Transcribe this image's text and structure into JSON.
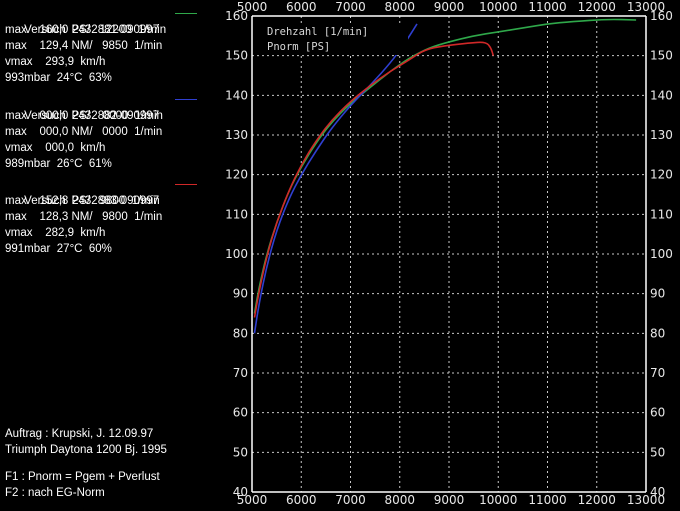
{
  "runs": [
    {
      "title": "Versuch  2432881-090997",
      "color": "#2fa84a",
      "lines": [
        "max    160,0 PS/   12200  1/min",
        "max    129,4 NM/   9850  1/min",
        "vmax    293,9  km/h",
        "993mbar  24°C  63%"
      ]
    },
    {
      "title": "Versuch  2432882-090997",
      "color": "#2f3fd0",
      "lines": [
        "max    000,0 PS/    0000  1/min",
        "max    000,0 NM/   0000  1/min",
        "vmax    000,0  km/h",
        "989mbar  26°C  61%"
      ]
    },
    {
      "title": "Versuch  2432883-090997",
      "color": "#d02828",
      "lines": [
        "max    152,8 PS/   9800  1/min",
        "max    128,3 NM/   9800  1/min",
        "vmax    282,9  km/h",
        "991mbar  27°C  60%"
      ]
    }
  ],
  "notes": {
    "order": "Auftrag : Krupski, J. 12.09.97",
    "vehicle": "Triumph Daytona 1200 Bj. 1995",
    "f1": "F1 : Pnorm = Pgem + Pverlust",
    "f2": "F2 : nach EG-Norm"
  },
  "chart_data": {
    "type": "line",
    "x_label": "Drehzahl [1/min]",
    "y_label": "Pnorm [PS]",
    "xlim": [
      5000,
      13000
    ],
    "ylim": [
      40,
      160
    ],
    "x_ticks": [
      5000,
      6000,
      7000,
      8000,
      9000,
      10000,
      11000,
      12000,
      13000
    ],
    "y_ticks": [
      40,
      50,
      60,
      70,
      80,
      90,
      100,
      110,
      120,
      130,
      140,
      150,
      160
    ],
    "grid": true,
    "axis_color": "#ffffff",
    "grid_color": "#c8c8c8",
    "series": [
      {
        "color": "#2fa84a",
        "points": [
          [
            5050,
            85
          ],
          [
            5150,
            92
          ],
          [
            5300,
            100
          ],
          [
            5500,
            108
          ],
          [
            5750,
            116
          ],
          [
            6000,
            122
          ],
          [
            6300,
            128
          ],
          [
            6600,
            133
          ],
          [
            7000,
            138
          ],
          [
            7400,
            142
          ],
          [
            7800,
            146
          ],
          [
            8200,
            149.5
          ],
          [
            8600,
            152
          ],
          [
            9000,
            153.5
          ],
          [
            9500,
            155
          ],
          [
            10000,
            156
          ],
          [
            10500,
            157
          ],
          [
            11000,
            158
          ],
          [
            11500,
            158.6
          ],
          [
            12200,
            159.2
          ],
          [
            12800,
            159
          ]
        ]
      },
      {
        "color": "#2f3fd0",
        "points": [
          [
            5050,
            80
          ],
          [
            5150,
            88
          ],
          [
            5300,
            97
          ],
          [
            5500,
            106
          ],
          [
            5750,
            114
          ],
          [
            6000,
            120
          ],
          [
            6300,
            126
          ],
          [
            6600,
            131.5
          ],
          [
            7000,
            137.5
          ],
          [
            7400,
            142.5
          ],
          [
            7800,
            148
          ],
          [
            8100,
            153
          ],
          [
            8350,
            158
          ]
        ]
      },
      {
        "color": "#d02828",
        "points": [
          [
            5050,
            84
          ],
          [
            5150,
            91
          ],
          [
            5300,
            99.5
          ],
          [
            5500,
            108
          ],
          [
            5750,
            116
          ],
          [
            6000,
            122.5
          ],
          [
            6300,
            128.5
          ],
          [
            6600,
            133.5
          ],
          [
            7000,
            138.5
          ],
          [
            7400,
            142.5
          ],
          [
            7800,
            146
          ],
          [
            8200,
            149
          ],
          [
            8500,
            151.5
          ],
          [
            8900,
            152.5
          ],
          [
            9400,
            153.2
          ],
          [
            9750,
            153.5
          ],
          [
            9850,
            152
          ],
          [
            9900,
            150
          ]
        ]
      }
    ]
  }
}
